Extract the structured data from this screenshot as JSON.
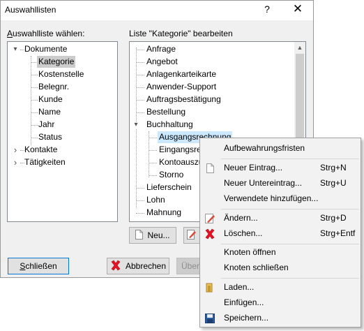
{
  "window": {
    "title": "Auswahllisten",
    "help_glyph": "?",
    "close_glyph": "✕"
  },
  "left_panel": {
    "label_prefix": "A",
    "label_rest": "uswahlliste wählen:",
    "tree": [
      {
        "label": "Dokumente",
        "expander": "▾"
      },
      {
        "label": "Kategorie"
      },
      {
        "label": "Kostenstelle"
      },
      {
        "label": "Belegnr."
      },
      {
        "label": "Kunde"
      },
      {
        "label": "Name"
      },
      {
        "label": "Jahr"
      },
      {
        "label": "Status"
      },
      {
        "label": "Kontakte",
        "expander": "›"
      },
      {
        "label": "Tätigkeiten",
        "expander": "›"
      }
    ]
  },
  "right_panel": {
    "label": "Liste \"Kategorie\" bearbeiten",
    "items": [
      {
        "label": "Anfrage"
      },
      {
        "label": "Angebot"
      },
      {
        "label": "Anlagenkarteikarte"
      },
      {
        "label": "Anwender-Support"
      },
      {
        "label": "Auftragsbestätigung"
      },
      {
        "label": "Bestellung"
      },
      {
        "label": "Buchhaltung",
        "expander": "▾"
      },
      {
        "label": "Ausgangsrechnung"
      },
      {
        "label": "Eingangsrechnung"
      },
      {
        "label": "Kontoauszug"
      },
      {
        "label": "Storno"
      },
      {
        "label": "Lieferschein"
      },
      {
        "label": "Lohn"
      },
      {
        "label": "Mahnung"
      }
    ],
    "scroll_up": "▲",
    "new_button": "Neu...",
    "edit_button_text": ""
  },
  "footer": {
    "close_button_prefix": "S",
    "close_button_rest": "chließen",
    "cancel_button": "Abbrechen",
    "apply_button": "Über"
  },
  "context_menu": {
    "items": [
      {
        "label": "Aufbewahrungsfristen",
        "shortcut": "",
        "icon": ""
      },
      {
        "label": "Neuer Eintrag...",
        "shortcut": "Strg+N",
        "icon": "new-document-icon"
      },
      {
        "label": "Neuer Untereintrag...",
        "shortcut": "Strg+U",
        "icon": ""
      },
      {
        "label": "Verwendete hinzufügen...",
        "shortcut": "",
        "icon": ""
      },
      {
        "label": "Ändern...",
        "shortcut": "Strg+D",
        "icon": "edit-pencil-icon"
      },
      {
        "label": "Löschen...",
        "shortcut": "Strg+Entf",
        "icon": "delete-x-icon"
      },
      {
        "label": "Knoten öffnen",
        "shortcut": "",
        "icon": ""
      },
      {
        "label": "Knoten schließen",
        "shortcut": "",
        "icon": ""
      },
      {
        "label": "Laden...",
        "shortcut": "",
        "icon": "open-folder-icon"
      },
      {
        "label": "Einfügen...",
        "shortcut": "",
        "icon": ""
      },
      {
        "label": "Speichern...",
        "shortcut": "",
        "icon": "save-floppy-icon"
      }
    ]
  },
  "colors": {
    "selection_gray": "#cccccc",
    "hover_blue": "#cce8ff",
    "delete_red": "#e81123",
    "focus_blue": "#0078d7"
  }
}
